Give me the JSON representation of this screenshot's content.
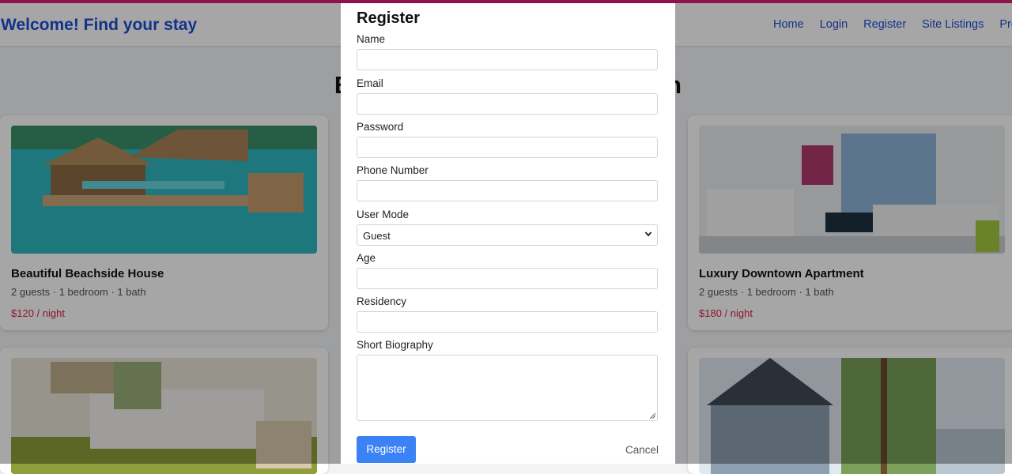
{
  "header": {
    "brand": "Welcome! Find your stay",
    "nav": [
      "Home",
      "Login",
      "Register",
      "Site Listings",
      "Profile"
    ]
  },
  "hero": {
    "title": "Explore stays on our platform"
  },
  "listings": [
    {
      "title": "Beautiful Beachside House",
      "meta": "2 guests · 1 bedroom · 1 bath",
      "price": "$120 / night"
    },
    {
      "title": "Luxury Downtown Apartment",
      "meta": "2 guests · 1 bedroom · 1 bath",
      "price": "$180 / night"
    }
  ],
  "modal": {
    "title": "Register",
    "fields": {
      "name": {
        "label": "Name",
        "value": ""
      },
      "email": {
        "label": "Email",
        "value": ""
      },
      "password": {
        "label": "Password",
        "value": ""
      },
      "phone": {
        "label": "Phone Number",
        "value": ""
      },
      "user_mode": {
        "label": "User Mode",
        "value": "Guest"
      },
      "age": {
        "label": "Age",
        "value": ""
      },
      "residency": {
        "label": "Residency",
        "value": ""
      },
      "bio": {
        "label": "Short Biography",
        "value": ""
      }
    },
    "submit_label": "Register",
    "cancel_label": "Cancel"
  },
  "colors": {
    "accent": "#e11d74",
    "brand": "#1d4ed8",
    "primary_button": "#3b82f6",
    "price": "#e11d48"
  }
}
